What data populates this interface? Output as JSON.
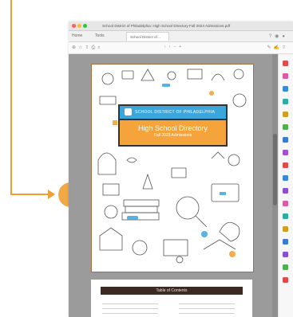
{
  "window": {
    "title": "School District of Philadelphia: High School Directory Fall 2023 Admissions.pdf"
  },
  "tab_bar": {
    "home_label": "Home",
    "tools_label": "Tools",
    "document_tab": "School District of…"
  },
  "cover": {
    "district_name": "SCHOOL DISTRICT OF PHILADELPHIA",
    "directory_title": "High School Directory",
    "directory_subtitle": "Fall 2023 Admissions"
  },
  "toc": {
    "header": "Table of Contents"
  },
  "colors": {
    "callout": "#f0a030",
    "district_band": "#3aa6dc",
    "directory_band": "#f4a43a",
    "toc_header": "#3a2a22"
  }
}
